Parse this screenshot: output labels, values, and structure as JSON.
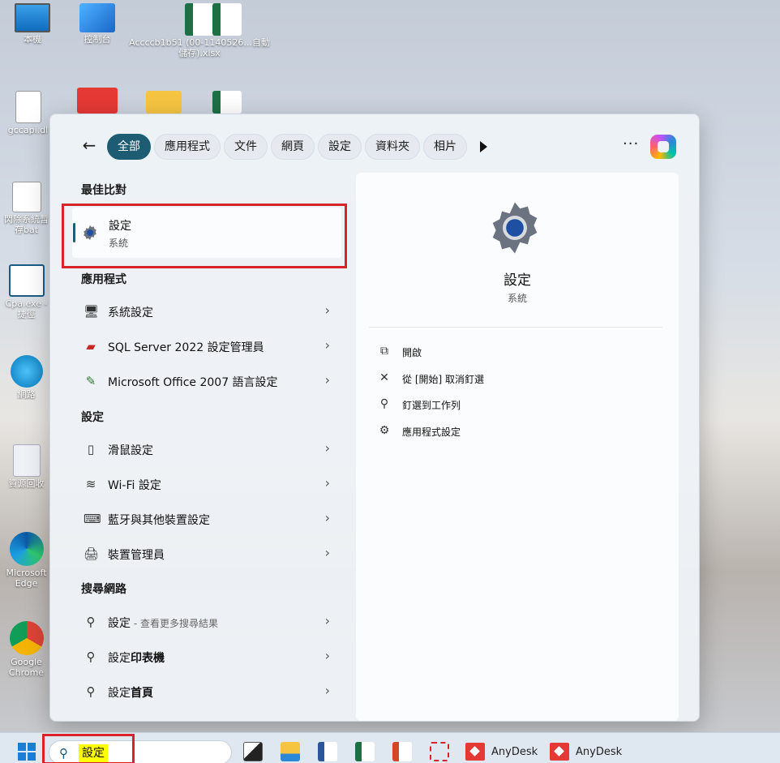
{
  "desktop": {
    "icons": [
      {
        "label": "本機"
      },
      {
        "label": "控制台"
      },
      {
        "label": "Accccb1b51 (00-1140526...自動儲存).xlsx"
      },
      {
        "label": "gccapi.dl"
      },
      {
        "label": "閃除系統暫存bat"
      },
      {
        "label": "Cpa.exe - 捷徑"
      },
      {
        "label": "網路"
      },
      {
        "label": "資源回收"
      },
      {
        "label": "Microsoft Edge"
      },
      {
        "label": "Google Chrome"
      }
    ]
  },
  "menu": {
    "filters": [
      "全部",
      "應用程式",
      "文件",
      "網頁",
      "設定",
      "資料夾",
      "相片"
    ],
    "sections": {
      "best_match": "最佳比對",
      "apps": "應用程式",
      "settings": "設定",
      "web": "搜尋網路"
    },
    "best_match": {
      "title": "設定",
      "subtitle": "系統"
    },
    "apps": [
      {
        "label": "系統設定"
      },
      {
        "label": "SQL Server 2022 設定管理員"
      },
      {
        "label": "Microsoft Office 2007 語言設定"
      }
    ],
    "settings": [
      {
        "label": "滑鼠設定"
      },
      {
        "label": "Wi-Fi 設定"
      },
      {
        "label": "藍牙與其他裝置設定"
      },
      {
        "label": "裝置管理員"
      }
    ],
    "web": [
      {
        "prefix": "設定",
        "hint": " - 查看更多搜尋結果"
      },
      {
        "prefix": "設定",
        "bold": "印表機"
      },
      {
        "prefix": "設定",
        "bold": "首頁"
      }
    ],
    "detail": {
      "title": "設定",
      "subtitle": "系統",
      "actions": [
        {
          "label": "開啟",
          "icon": "open-external-icon"
        },
        {
          "label": "從 [開始] 取消釘選",
          "icon": "unpin-icon"
        },
        {
          "label": "釘選到工作列",
          "icon": "pin-icon"
        },
        {
          "label": "應用程式設定",
          "icon": "gear-icon"
        }
      ]
    }
  },
  "taskbar": {
    "search_value": "設定",
    "anydesk_1": "AnyDesk",
    "anydesk_2": "AnyDesk"
  },
  "colors": {
    "accent": "#1d5c73",
    "highlight_box": "#d9232a",
    "search_highlight": "#ffff00"
  }
}
